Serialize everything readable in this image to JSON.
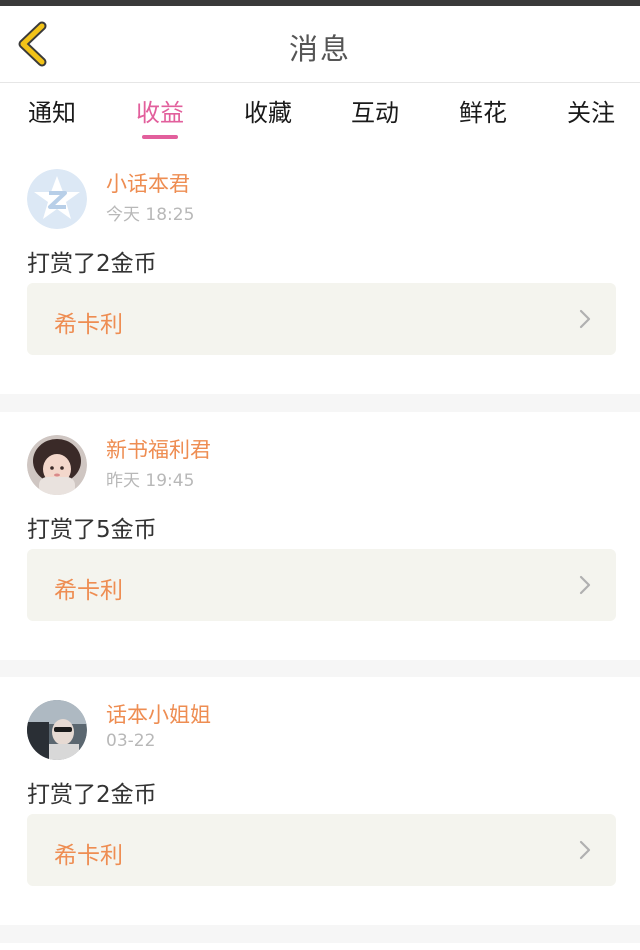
{
  "header": {
    "title": "消息"
  },
  "tabs": [
    {
      "label": "通知"
    },
    {
      "label": "收益"
    },
    {
      "label": "收藏"
    },
    {
      "label": "互动"
    },
    {
      "label": "鲜花"
    },
    {
      "label": "关注"
    }
  ],
  "active_tab": "收益",
  "messages": [
    {
      "user": "小话本君",
      "time": "今天 18:25",
      "text": "打赏了2金币",
      "book": "希卡利",
      "avatar_icon": "star-z-logo-icon"
    },
    {
      "user": "新书福利君",
      "time": "昨天 19:45",
      "text": "打赏了5金币",
      "book": "希卡利",
      "avatar_icon": "girl-photo-avatar"
    },
    {
      "user": "话本小姐姐",
      "time": "03-22",
      "text": "打赏了2金币",
      "book": "希卡利",
      "avatar_icon": "man-in-car-photo-avatar"
    }
  ],
  "colors": {
    "accent_pink": "#e25f9c",
    "name_orange": "#ee8d52",
    "back_yellow": "#f2c318",
    "card_bg": "#f4f4ee"
  }
}
